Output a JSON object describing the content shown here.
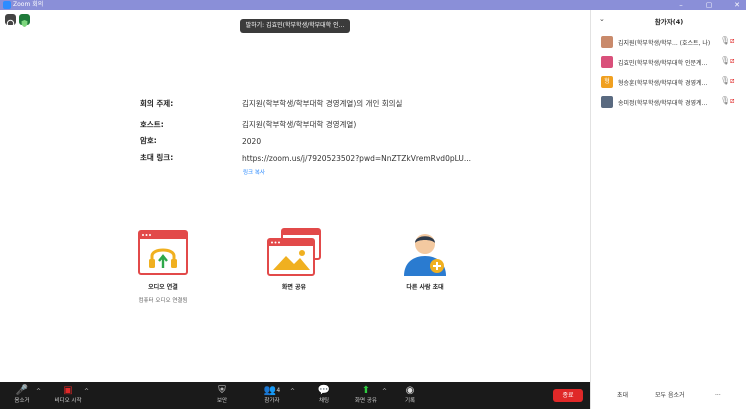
{
  "window": {
    "title": "Zoom 회의",
    "controls": [
      "–",
      "▢",
      "✕"
    ]
  },
  "speaker_banner": "발하기: 김효민(학부학생/학부대학 인...",
  "meeting": {
    "topic_label": "회의 주제:",
    "topic_value": "김지원(학부학생/학부대학 경영계열)의 개인 회의실",
    "host_label": "호스트:",
    "host_value": "김지원(학부학생/학부대학 경영계열)",
    "password_label": "암호:",
    "password_value": "2020",
    "invite_label": "초대 링크:",
    "invite_value": "https://zoom.us/j/7920523502?pwd=NnZTZkVremRvd0pLU...",
    "copy_link": "링크 복사"
  },
  "options": {
    "audio_label": "오디오 연결",
    "audio_sub": "컴퓨터 오디오 연결됨",
    "share_label": "화면 공유",
    "invite_label": "다른 사람 초대"
  },
  "participants_panel": {
    "title": "참가자(4)",
    "participants": [
      {
        "name": "김지원(학부학생/학부... (호스트, 나)",
        "avatar_color": "#c98a6b"
      },
      {
        "name": "김효민(학부학생/학부대학 인문계...",
        "avatar_color": "#d9507a"
      },
      {
        "name": "형승훈(학부학생/학부대학 경영계...",
        "avatar_color": "#f0a020",
        "initial": "형"
      },
      {
        "name": "송미정(학부학생/학부대학 경영계...",
        "avatar_color": "#5a6a80"
      }
    ],
    "invite_button": "초대",
    "mute_all_button": "모두 음소거",
    "more_button": "..."
  },
  "toolbar": {
    "mute": "음소거",
    "video": "비디오 시작",
    "security": "보안",
    "participants": "참가자",
    "participants_count": "4",
    "chat": "채팅",
    "share": "화면 공유",
    "record": "기록",
    "end": "종료"
  },
  "colors": {
    "accent": "#2d8cff",
    "end": "#e02828",
    "titlebar": "#8a8fd8",
    "share_green": "#2ecc40"
  }
}
